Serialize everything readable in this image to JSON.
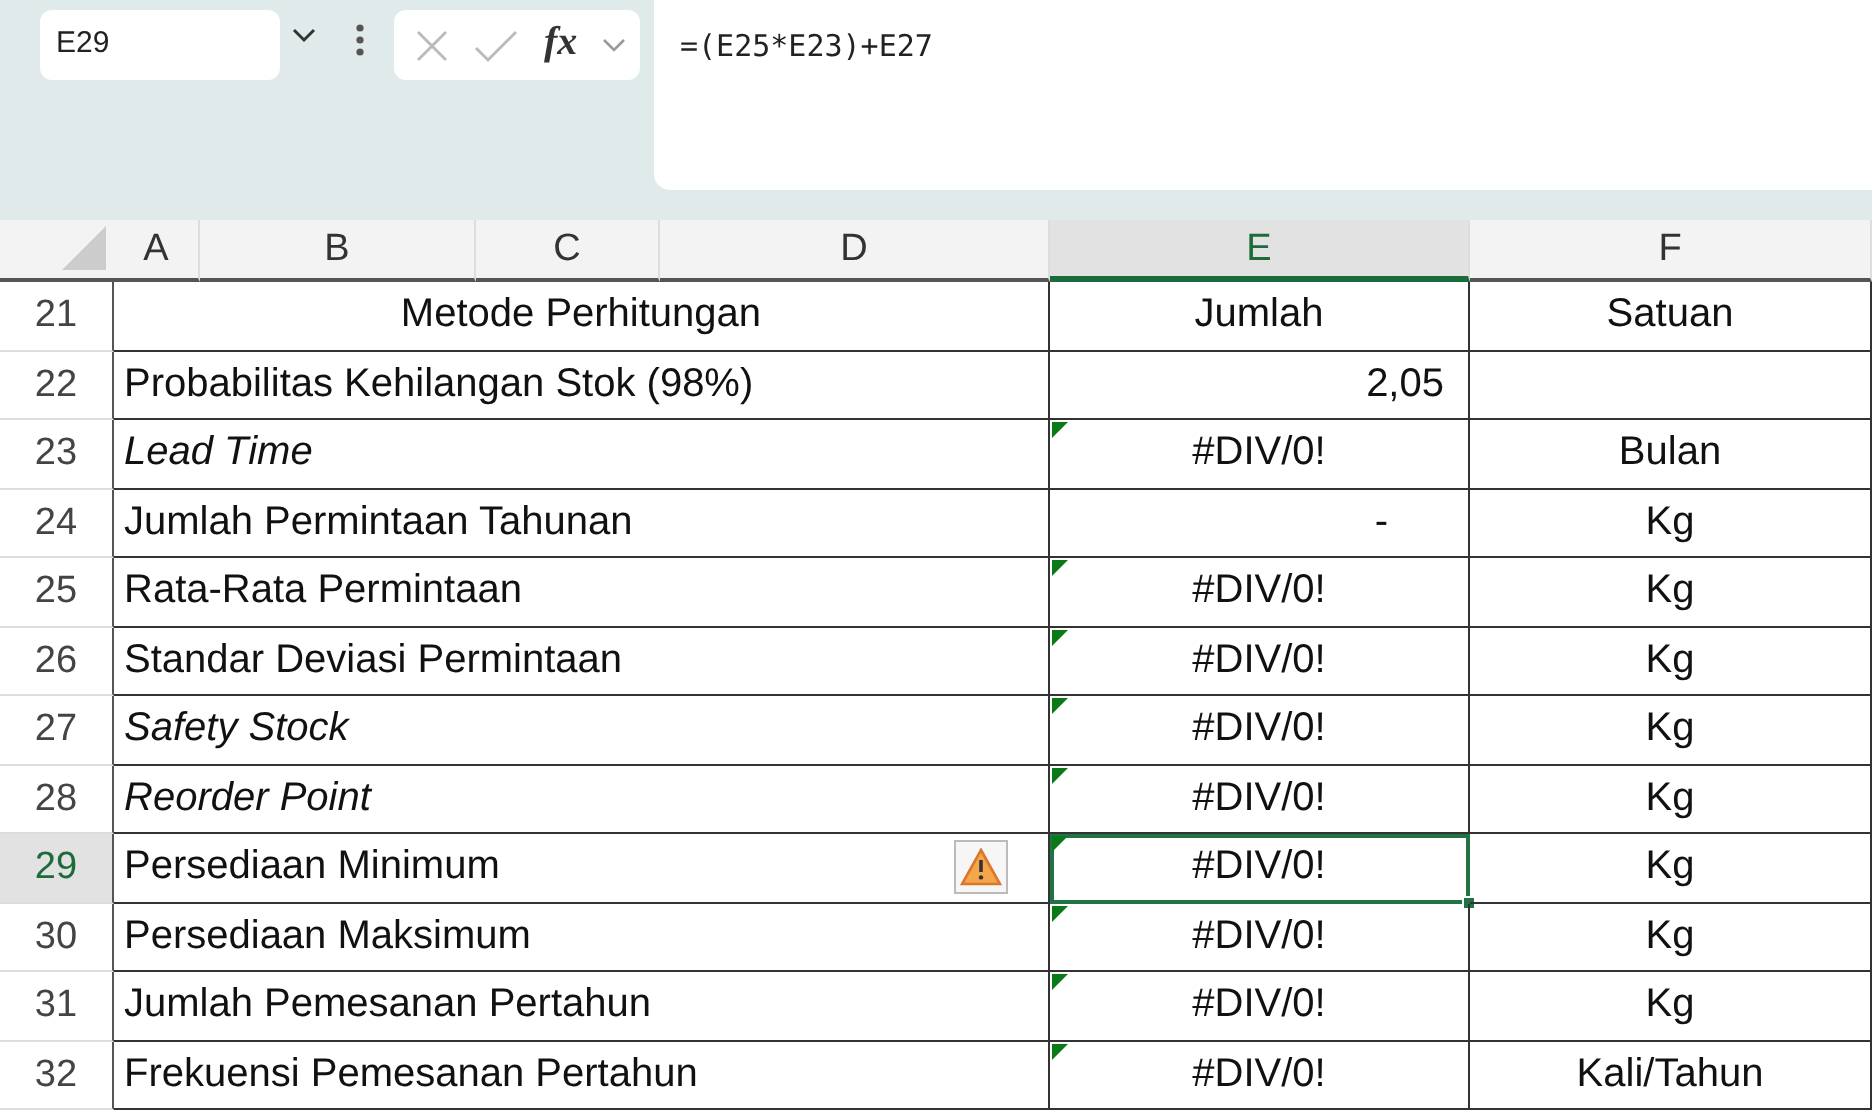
{
  "formula_bar": {
    "name_box": "E29",
    "function_label": "fx",
    "formula": "=(E25*E23)+E27"
  },
  "columns": [
    {
      "label": "A",
      "selected": false
    },
    {
      "label": "B",
      "selected": false
    },
    {
      "label": "C",
      "selected": false
    },
    {
      "label": "D",
      "selected": false
    },
    {
      "label": "E",
      "selected": true
    },
    {
      "label": "F",
      "selected": false
    }
  ],
  "rows": [
    {
      "number": "21",
      "kind": "heading",
      "label": "Metode Perhitungan",
      "italic": false,
      "value": {
        "kind": "text",
        "text": "Jumlah"
      },
      "error": false,
      "warning": false,
      "selected": false,
      "unit": "Satuan"
    },
    {
      "number": "22",
      "kind": "data",
      "label": "Probabilitas Kehilangan Stok (98%)",
      "italic": false,
      "value": {
        "kind": "number",
        "text": "2,05"
      },
      "error": false,
      "warning": false,
      "selected": false
    },
    {
      "number": "23",
      "kind": "data",
      "label": "Lead Time",
      "italic": true,
      "value": {
        "kind": "text",
        "text": "#DIV/0!"
      },
      "error": true,
      "warning": false,
      "selected": false,
      "unit": "Bulan"
    },
    {
      "number": "24",
      "kind": "data",
      "label": "Jumlah Permintaan Tahunan",
      "italic": false,
      "value": {
        "kind": "accounting",
        "text": "-"
      },
      "error": false,
      "warning": false,
      "selected": false,
      "unit": "Kg"
    },
    {
      "number": "25",
      "kind": "data",
      "label": "Rata-Rata Permintaan",
      "italic": false,
      "value": {
        "kind": "text",
        "text": "#DIV/0!"
      },
      "error": true,
      "warning": false,
      "selected": false,
      "unit": "Kg"
    },
    {
      "number": "26",
      "kind": "data",
      "label": "Standar Deviasi Permintaan",
      "italic": false,
      "value": {
        "kind": "text",
        "text": "#DIV/0!"
      },
      "error": true,
      "warning": false,
      "selected": false,
      "unit": "Kg"
    },
    {
      "number": "27",
      "kind": "data",
      "label": "Safety Stock",
      "italic": true,
      "value": {
        "kind": "text",
        "text": "#DIV/0!"
      },
      "error": true,
      "warning": false,
      "selected": false,
      "unit": "Kg"
    },
    {
      "number": "28",
      "kind": "data",
      "label": "Reorder Point",
      "italic": true,
      "value": {
        "kind": "text",
        "text": "#DIV/0!"
      },
      "error": true,
      "warning": false,
      "selected": false,
      "unit": "Kg"
    },
    {
      "number": "29",
      "kind": "data",
      "label": "Persediaan Minimum",
      "italic": false,
      "value": {
        "kind": "text",
        "text": "#DIV/0!"
      },
      "error": true,
      "warning": true,
      "selected": true,
      "unit": "Kg"
    },
    {
      "number": "30",
      "kind": "data",
      "label": "Persediaan Maksimum",
      "italic": false,
      "value": {
        "kind": "text",
        "text": "#DIV/0!"
      },
      "error": true,
      "warning": false,
      "selected": false,
      "unit": "Kg"
    },
    {
      "number": "31",
      "kind": "data",
      "label": "Jumlah Pemesanan Pertahun",
      "italic": false,
      "value": {
        "kind": "text",
        "text": "#DIV/0!"
      },
      "error": true,
      "warning": false,
      "selected": false,
      "unit": "Kg"
    },
    {
      "number": "32",
      "kind": "data",
      "label": "Frekuensi Pemesanan Pertahun",
      "italic": false,
      "value": {
        "kind": "text",
        "text": "#DIV/0!"
      },
      "error": true,
      "warning": false,
      "selected": false,
      "unit": "Kali/Tahun"
    }
  ]
}
